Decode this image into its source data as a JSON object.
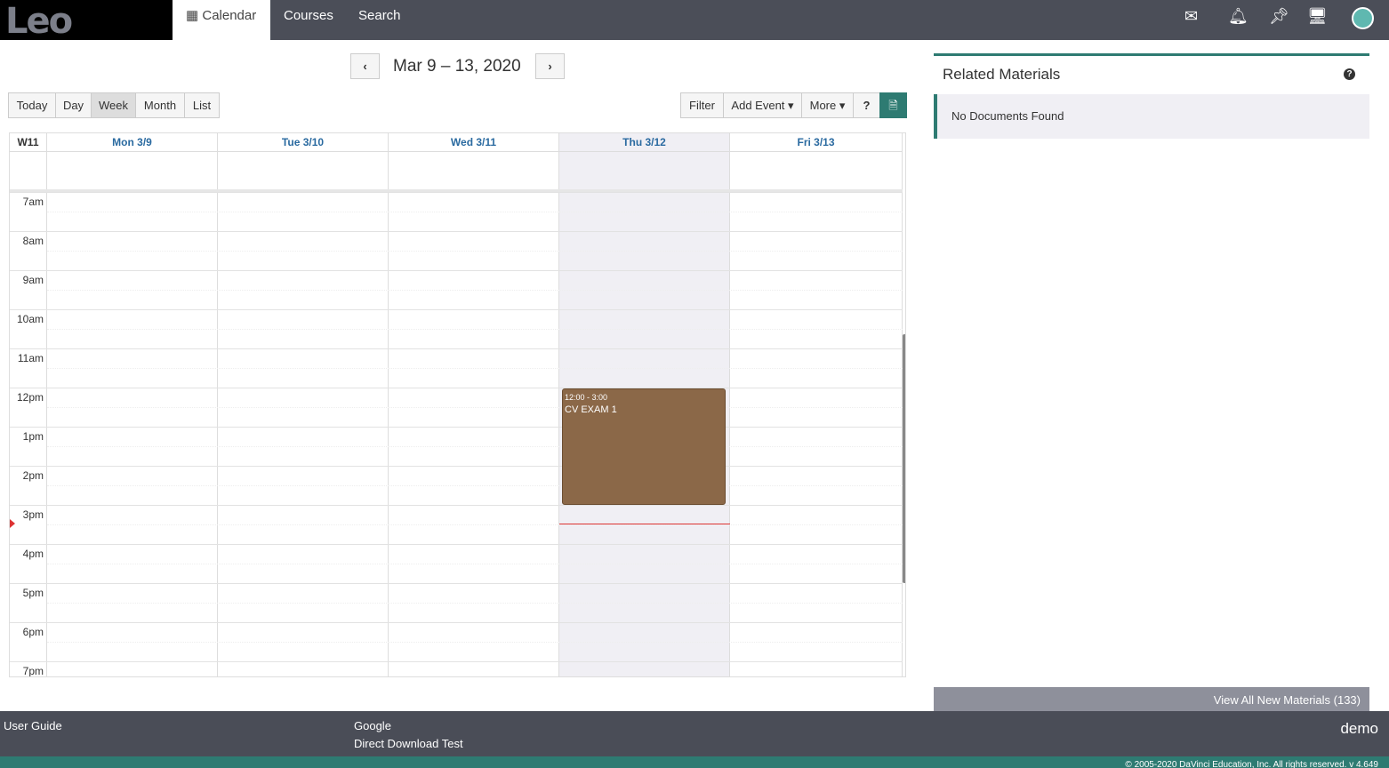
{
  "app": {
    "logo": "Leo"
  },
  "nav": {
    "items": [
      {
        "label": "Calendar",
        "icon": "calendar-icon"
      },
      {
        "label": "Courses"
      },
      {
        "label": "Search"
      }
    ]
  },
  "top_icons": [
    "mail-icon",
    "bell-icon",
    "pin-icon",
    "monitor-icon",
    "user-avatar-icon"
  ],
  "calendar": {
    "range_title": "Mar 9 – 13, 2020",
    "views": [
      "Today",
      "Day",
      "Week",
      "Month",
      "List"
    ],
    "active_view": "Week",
    "actions": {
      "filter": "Filter",
      "add_event": "Add Event",
      "more": "More"
    },
    "week_label": "W11",
    "days": [
      "Mon 3/9",
      "Tue 3/10",
      "Wed 3/11",
      "Thu 3/12",
      "Fri 3/13"
    ],
    "today_index": 3,
    "hours": [
      "7am",
      "8am",
      "9am",
      "10am",
      "11am",
      "12pm",
      "1pm",
      "2pm",
      "3pm",
      "4pm",
      "5pm",
      "6pm",
      "7pm"
    ],
    "events": [
      {
        "time": "12:00 - 3:00",
        "title": "CV EXAM 1",
        "day": "Thu 3/12",
        "color": "#8b6848"
      }
    ]
  },
  "related": {
    "title": "Related Materials",
    "empty": "No Documents Found",
    "view_all": "View All New Materials (133)"
  },
  "footer": {
    "links": [
      "User Guide",
      "Google",
      "Direct Download Test"
    ],
    "user": "demo",
    "copyright": "© 2005-2020 DaVinci Education, Inc. All rights reserved. v 4.649"
  }
}
